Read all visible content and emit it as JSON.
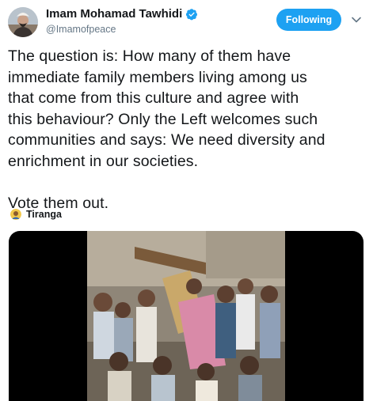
{
  "author": {
    "display_name": "Imam Mohamad Tawhidi",
    "handle": "@Imamofpeace",
    "verified": true
  },
  "actions": {
    "follow_label": "Following",
    "menu_icon": "chevron-down-icon"
  },
  "tweet": {
    "lines": [
      "The question is: How many of them have",
      "immediate family members living among us",
      "that come from this culture and agree with",
      "this behaviour? Only the Left welcomes such",
      "communities and says: We need diversity and",
      "enrichment in our societies."
    ],
    "closing": "Vote them out."
  },
  "source": {
    "label": "Tiranga"
  },
  "media": {
    "type": "video"
  },
  "colors": {
    "accent": "#1da1f2",
    "text": "#14171a",
    "muted": "#657786"
  }
}
